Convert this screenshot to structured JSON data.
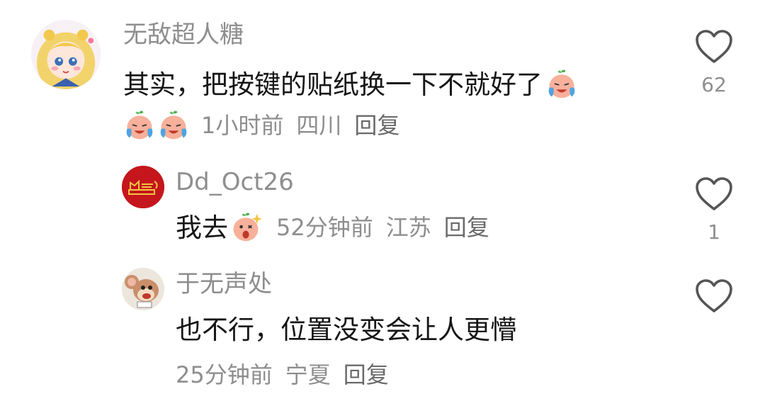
{
  "comments": [
    {
      "username": "无敌超人糖",
      "text": "其实，把按键的贴纸换一下不就好了",
      "text_emojis": [
        "crying-laugh-emoji"
      ],
      "meta_emojis": [
        "crying-laugh-emoji",
        "crying-laugh-emoji"
      ],
      "time": "1小时前",
      "location": "四川",
      "reply": "回复",
      "likes": "62"
    },
    {
      "username": "Dd_Oct26",
      "text": "我去",
      "text_emojis": [
        "shocked-emoji"
      ],
      "time": "52分钟前",
      "location": "江苏",
      "reply": "回复",
      "likes": "1"
    },
    {
      "username": "于无声处",
      "text": "也不行，位置没变会让人更懵",
      "time": "25分钟前",
      "location": "宁夏",
      "reply": "回复",
      "likes": ""
    }
  ],
  "colors": {
    "text": "#161616",
    "secondary": "#8e8e8e",
    "avatar_red": "#c4161c"
  }
}
